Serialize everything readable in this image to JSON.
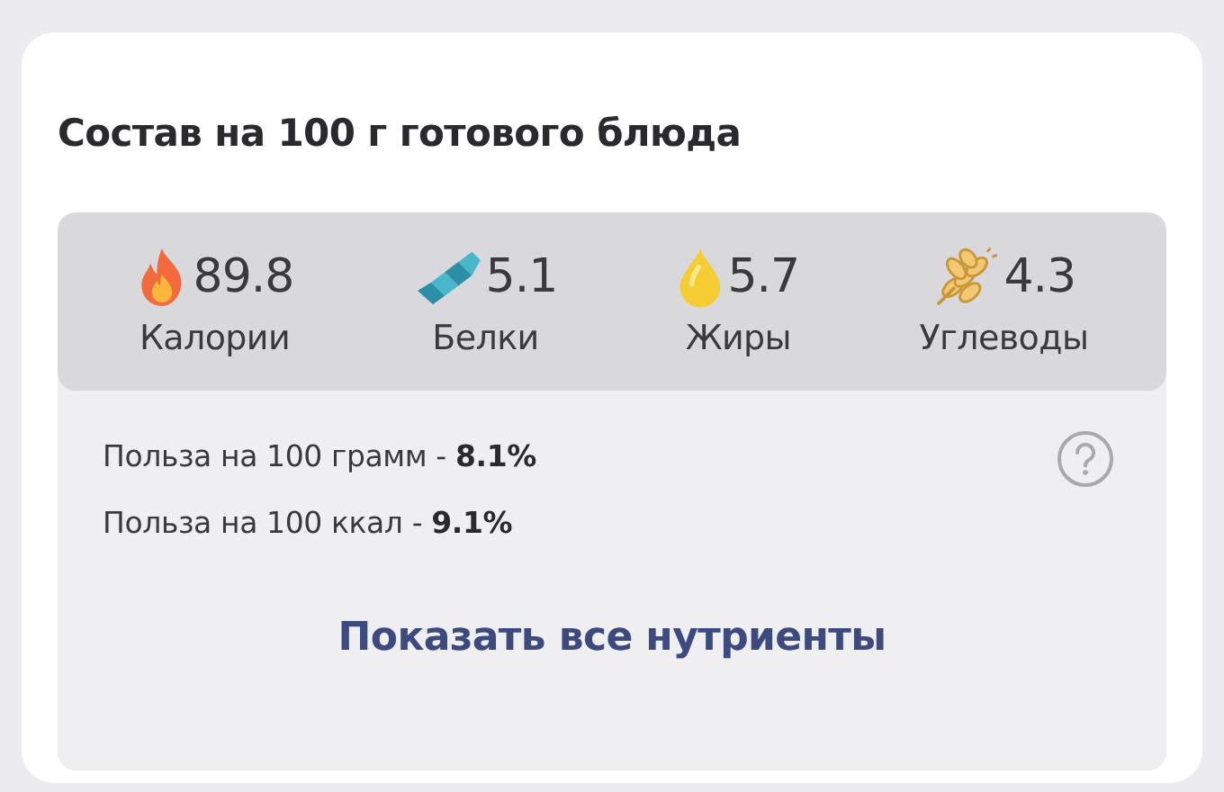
{
  "title": "Состав на 100 г готового блюда",
  "nutrients": [
    {
      "kind": "calories",
      "value": "89.8",
      "label": "Калории"
    },
    {
      "kind": "protein",
      "value": "5.1",
      "label": "Белки"
    },
    {
      "kind": "fat",
      "value": "5.7",
      "label": "Жиры"
    },
    {
      "kind": "carbs",
      "value": "4.3",
      "label": "Углеводы"
    }
  ],
  "benefits": [
    "Польза на 100 грамм - **8.1%**",
    "Польза на 100 ккал - **9.1%**"
  ],
  "show_all_link": "Показать все нутриенты"
}
